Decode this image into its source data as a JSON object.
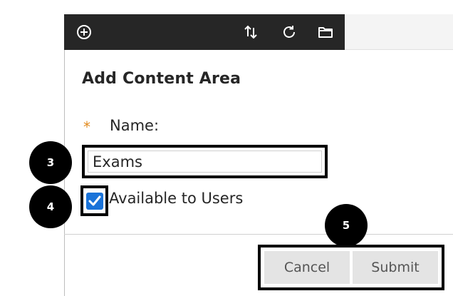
{
  "toolbar": {
    "icons": [
      "add-circle-icon",
      "sort-arrows-icon",
      "refresh-icon",
      "folder-icon"
    ],
    "background": "#262626"
  },
  "form": {
    "title": "Add Content Area",
    "required_marker": "*",
    "name_label": "Name:",
    "name_value": "Exams",
    "available_label": "Available to Users",
    "available_checked": true
  },
  "buttons": {
    "cancel_label": "Cancel",
    "submit_label": "Submit"
  },
  "markers": {
    "step_3": "3",
    "step_4": "4",
    "step_5": "5"
  },
  "colors": {
    "required_star": "#e28a1e",
    "checkbox_fill": "#1a73d9",
    "highlight_border": "#000000"
  }
}
